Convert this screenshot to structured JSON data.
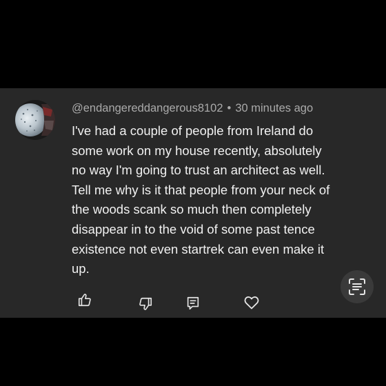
{
  "comment": {
    "author": "@endangereddangerous8102",
    "separator": "•",
    "time": "30 minutes ago",
    "text_lines": [
      "I've had a couple of people from Ireland do",
      "some work on my house recently, absolutely",
      "no way I'm going to trust an architect as well.",
      "Tell me why is it that people from your neck of",
      "the woods scank so much then completely",
      "disappear in to the void of some past tence",
      "existence not even startrek can even make it",
      "up."
    ]
  },
  "actions": [
    {
      "name": "like",
      "icon": "thumbs-up-icon"
    },
    {
      "name": "dislike",
      "icon": "thumbs-down-icon"
    },
    {
      "name": "reply",
      "icon": "reply-icon"
    },
    {
      "name": "heart",
      "icon": "heart-icon"
    }
  ],
  "overlay": {
    "icon": "text-scan-icon"
  },
  "colors": {
    "background": "#000000",
    "card": "#282828",
    "text": "#f1f1f1",
    "meta": "#aaaaaa"
  }
}
